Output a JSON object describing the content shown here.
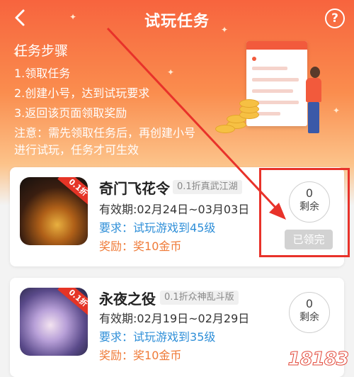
{
  "colors": {
    "header_gradient_top": "#f7643e",
    "header_gradient_bottom": "#fcc38a",
    "link_blue": "#2f8fd8",
    "reward_orange": "#ef7a37",
    "highlight_red": "#e8322a",
    "claimed_gray": "#d2d2d2"
  },
  "nav": {
    "back_icon": "chevron-left-icon",
    "title": "试玩任务",
    "help_icon": "question-circle-icon",
    "help_label": "?"
  },
  "steps": {
    "title": "任务步骤",
    "items": [
      "1.领取任务",
      "2.创建小号，达到试玩要求",
      "3.返回该页面领取奖励"
    ],
    "note_line1": "注意：需先领取任务后，再创建小号",
    "note_line2": "进行试玩，任务才可生效"
  },
  "tasks": [
    {
      "name": "奇门飞花令",
      "tag": "0.1折真武江湖",
      "ribbon": "0.1折",
      "validity_label": "有效期:",
      "validity": "02月24日~03月03日",
      "req_label": "要求：",
      "req": "试玩游戏到45级",
      "reward_label": "奖励：",
      "reward": "奖10金币",
      "remaining_count": "0",
      "remaining_label": "剩余",
      "status_button": "已领完"
    },
    {
      "name": "永夜之役",
      "tag": "0.1折众神乱斗版",
      "ribbon": "0.1折",
      "validity_label": "有效期:",
      "validity": "02月19日~02月29日",
      "req_label": "要求：",
      "req": "试玩游戏到35级",
      "reward_label": "奖励：",
      "reward": "奖10金币",
      "remaining_count": "0",
      "remaining_label": "剩余"
    }
  ],
  "watermark": "18183"
}
